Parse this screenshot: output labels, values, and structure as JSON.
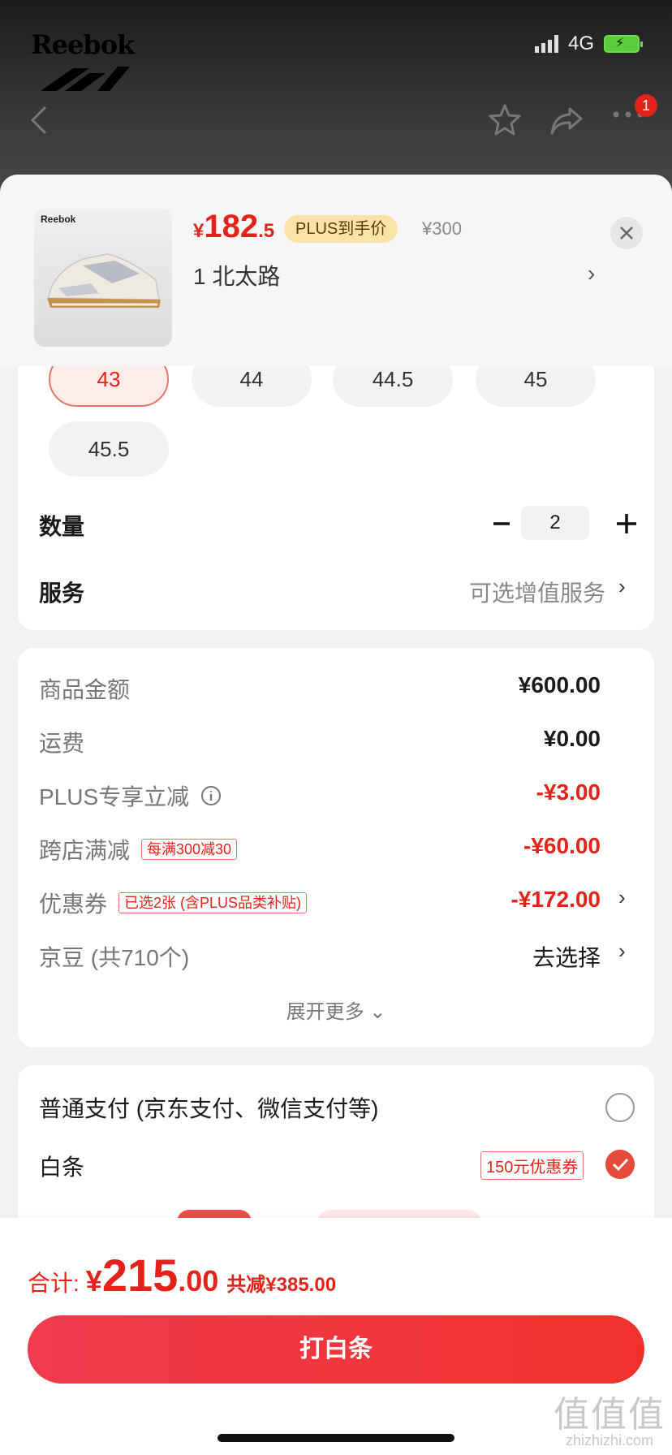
{
  "status_bar": {
    "network": "4G"
  },
  "brand": {
    "logo_text": "Reebok"
  },
  "header": {
    "cart_badge": "1"
  },
  "product": {
    "price_symbol": "¥",
    "price_int": "182",
    "price_dec": ".5",
    "plus_tag": "PLUS到手价",
    "original_price": "¥300",
    "variant": "1  北太路",
    "thumb_brand": "Reebok"
  },
  "sizes": [
    "43",
    "44",
    "44.5",
    "45",
    "45.5"
  ],
  "selected_size": "43",
  "quantity": {
    "label": "数量",
    "value": "2"
  },
  "service": {
    "label": "服务",
    "value": "可选增值服务"
  },
  "fees": {
    "goods_label": "商品金额",
    "goods_value": "¥600.00",
    "shipping_label": "运费",
    "shipping_value": "¥0.00",
    "plus_label": "PLUS专享立减",
    "plus_value": "-¥3.00",
    "cross_label": "跨店满减",
    "cross_tag": "每满300减30",
    "cross_value": "-¥60.00",
    "coupon_label": "优惠券",
    "coupon_tag": "已选2张 (含PLUS品类补贴)",
    "coupon_value": "-¥172.00",
    "beans_label": "京豆 (共710个)",
    "beans_value": "去选择",
    "expand": "展开更多"
  },
  "payment": {
    "normal_label": "普通支付 (京东支付、微信支付等)",
    "baitiao_label": "白条",
    "baitiao_coupon": "150元优惠券"
  },
  "total": {
    "label": "合计:",
    "symbol": "¥",
    "int": "215",
    "dec": ".00",
    "saved": "共减¥385.00"
  },
  "pay_button": "打白条",
  "watermark": {
    "big": "值值值",
    "small": "zhizhizhi.com"
  },
  "colors": {
    "accent": "#e2231a",
    "plus_tag_bg": "#fbe3a7"
  }
}
